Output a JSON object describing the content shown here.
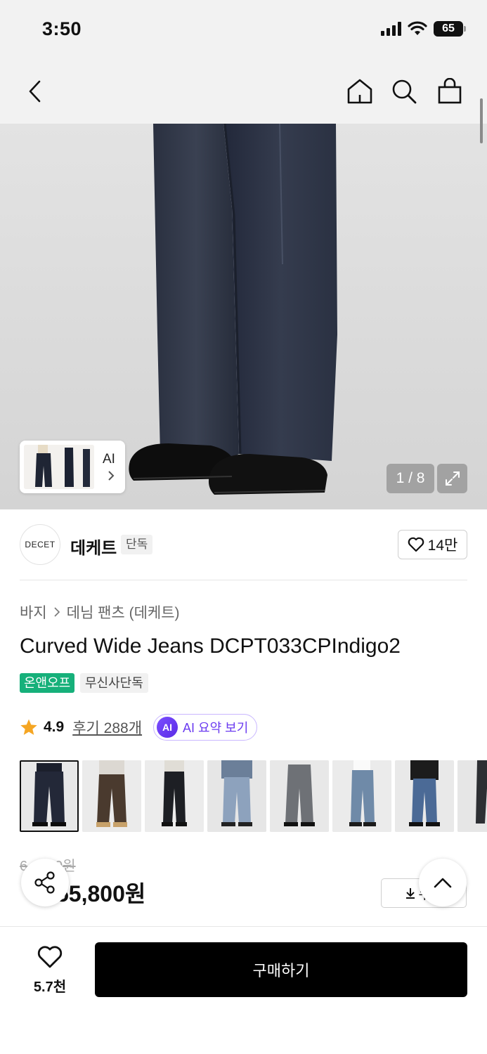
{
  "status_bar": {
    "time": "3:50",
    "battery": "65"
  },
  "header": {
    "icons": [
      "back-icon",
      "home-icon",
      "search-icon",
      "shopping-bag-icon"
    ]
  },
  "hero": {
    "ai_label": "AI",
    "page_counter": "1 / 8"
  },
  "brand": {
    "logo_text": "DECET",
    "name": "데케트",
    "tag": "단독",
    "likes": "14만"
  },
  "product": {
    "breadcrumb": [
      "바지",
      "데님 팬츠 (데케트)"
    ],
    "title": "Curved Wide Jeans DCPT033CPIndigo2",
    "badges": [
      "온앤오프",
      "무신사단독"
    ],
    "rating": "4.9",
    "reviews": "후기 288개",
    "ai_summary": "AI 요약 보기",
    "ai_badge": "AI"
  },
  "price": {
    "original": "6",
    "original_tail": "00원",
    "discount": "",
    "current": "55,800원",
    "coupon_label": "쿠폰"
  },
  "bottom_bar": {
    "wish_count": "5.7천",
    "buy_label": "구매하기"
  },
  "colors": {
    "accent_green": "#16b07a",
    "ai_purple": "#6b3cf0",
    "discount_red": "#e83a2b",
    "star": "#f5a623"
  }
}
